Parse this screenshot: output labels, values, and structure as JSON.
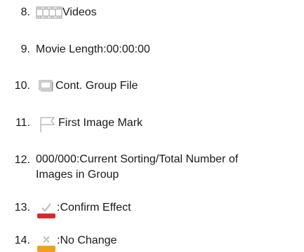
{
  "items": [
    {
      "number": "8.",
      "label": "Videos",
      "icon": "film-strip-icon"
    },
    {
      "number": "9.",
      "label": "Movie Length:00:00:00"
    },
    {
      "number": "10.",
      "label": "Cont. Group File",
      "icon": "continuous-group-file-icon"
    },
    {
      "number": "11.",
      "label": "First Image Mark",
      "icon": "flag-icon"
    },
    {
      "number": "12.",
      "label": "000/000:Current Sorting/Total Number of Images in Group"
    },
    {
      "number": "13.",
      "label": ":Confirm Effect",
      "icon": "confirm-checkmark-icon"
    },
    {
      "number": "14.",
      "label": ":No Change",
      "icon": "no-change-x-icon"
    }
  ],
  "colors": {
    "confirm_bar": "#d42a2a",
    "no_change_bar": "#f0a020",
    "icon_stroke": "#9a9a9a"
  }
}
